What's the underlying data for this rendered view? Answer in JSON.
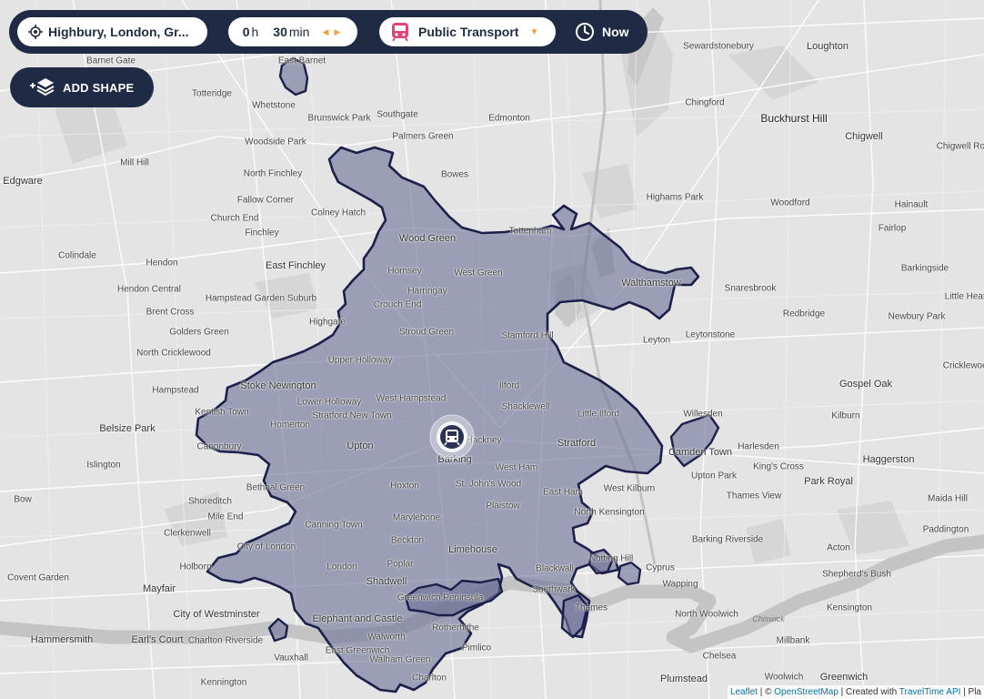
{
  "toolbar": {
    "location": "Highbury, London, Gr...",
    "hours": "0",
    "hours_unit": "h",
    "minutes": "30",
    "minutes_unit": "min",
    "transport_mode": "Public Transport",
    "time_label": "Now"
  },
  "add_shape_label": "ADD SHAPE",
  "colors": {
    "bar": "#1f2a44",
    "accent": "#f0a23a",
    "mode_icon": "#e0457b",
    "isochrone_fill": "#6f7298",
    "isochrone_stroke": "#1c1f4a"
  },
  "icons": {
    "location": "crosshair-icon",
    "mode": "train-icon",
    "time": "clock-icon",
    "add_shape": "layers-icon",
    "origin": "train-marker-icon"
  },
  "attribution": {
    "leaflet": "Leaflet",
    "sep1": " | © ",
    "osm": "OpenStreetMap",
    "sep2": " | Created with ",
    "tt": "TravelTime API",
    "tail": " | Pla"
  },
  "places": [
    "Barnet Gate",
    "East Barnet",
    "Sewardstonebury",
    "Loughton",
    "Totteridge",
    "Whetstone",
    "Brunswick Park",
    "Southgate",
    "Edmonton",
    "Chingford",
    "Buckhurst Hill",
    "Chigwell",
    "Woodside Park",
    "Palmers Green",
    "Chigwell Row",
    "Mill Hill",
    "Bowes",
    "North Finchley",
    "Edgware",
    "Fallow Corner",
    "Highams Park",
    "Woodford",
    "Hainault",
    "Church End",
    "Colney Hatch",
    "Finchley",
    "Wood Green",
    "Tottenham",
    "Fairlop",
    "Colindale",
    "Hendon",
    "East Finchley",
    "Hornsey",
    "West Green",
    "Walthamstow",
    "Barkingside",
    "Hendon Central",
    "Hampstead Garden Suburb",
    "Harringay",
    "Snaresbrook",
    "Little Heath",
    "Crouch End",
    "Redbridge",
    "Brent Cross",
    "Highgate",
    "Newbury Park",
    "Golders Green",
    "Stroud Green",
    "Stamford Hill",
    "Leyton",
    "Leytonstone",
    "North Cricklewood",
    "Upper Holloway",
    "Cricklewood",
    "Hampstead",
    "Stoke Newington",
    "Ilford",
    "Gospel Oak",
    "Lower Holloway",
    "West Hampstead",
    "Kentish Town",
    "Shacklewell",
    "Stratford New Town",
    "Willesden",
    "Belsize Park",
    "Homerton",
    "Little Ilford",
    "Kilburn",
    "Canonbury",
    "Hackney",
    "Stratford",
    "Camden Town",
    "Upton",
    "Harlesden",
    "Islington",
    "Barking",
    "Haggerston",
    "West Ham",
    "Upton Park",
    "King's Cross",
    "Hoxton",
    "St. John's Wood",
    "Bethnal Green",
    "East Ham",
    "Park Royal",
    "Bow",
    "West Kilburn",
    "Shoreditch",
    "Plaistow",
    "Thames View",
    "Maida Hill",
    "Mile End",
    "North Kensington",
    "Clerkenwell",
    "Marylebone",
    "Canning Town",
    "Barking Riverside",
    "Paddington",
    "City of London",
    "Limehouse",
    "Notting Hill",
    "Holborn",
    "Beckton",
    "Acton",
    "Covent Garden",
    "Poplar",
    "Cyprus",
    "Shepherd's Bush",
    "Mayfair",
    "London",
    "Shadwell",
    "Blackwall",
    "Wapping",
    "Southwark",
    "Greenwich Peninsula",
    "North Woolwich",
    "Kensington",
    "City of Westminster",
    "Elephant and Castle",
    "Rotherhithe",
    "Thames",
    "Chiswick",
    "Hammersmith",
    "Earl's Court",
    "Charlton Riverside",
    "Millbank",
    "Walworth",
    "Pimlico",
    "East Greenwich",
    "Chelsea",
    "Vauxhall",
    "Walham Green",
    "Kennington",
    "Charlton",
    "Woolwich",
    "Greenwich",
    "Plumstead"
  ]
}
